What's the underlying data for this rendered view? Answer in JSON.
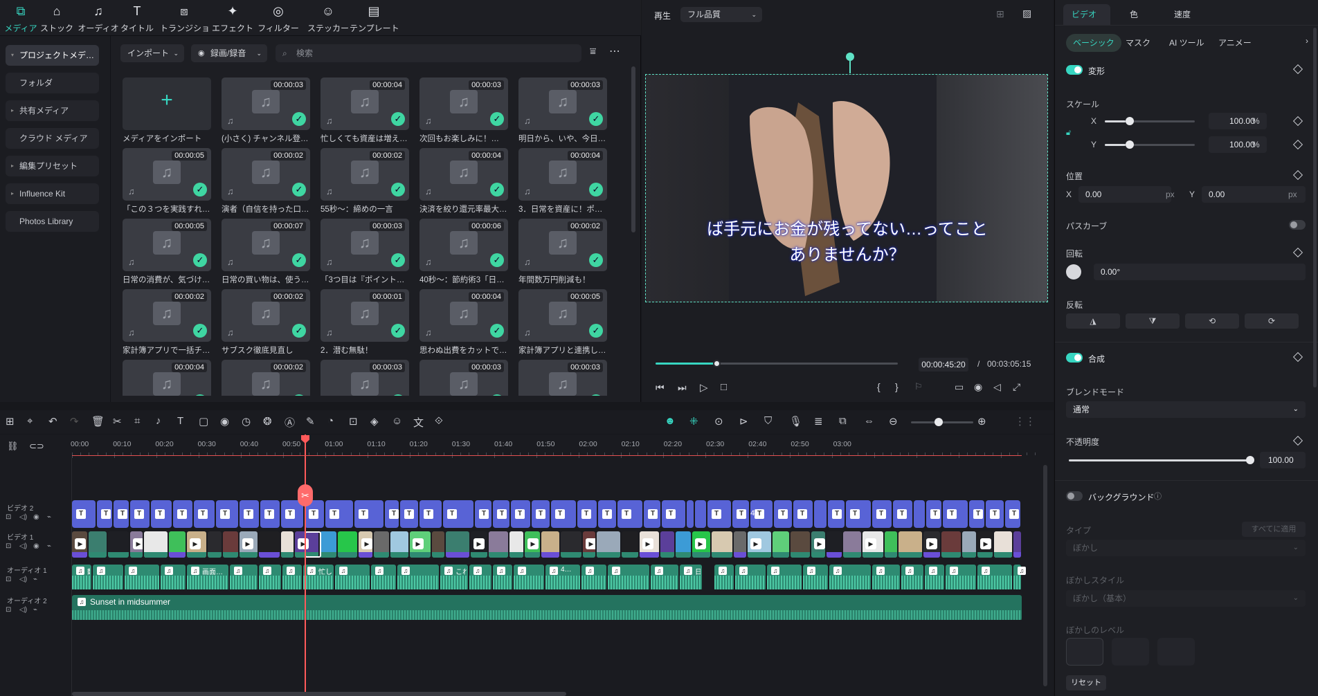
{
  "media_tabs": [
    {
      "label": "メディア",
      "icon": "media-icon",
      "active": true
    },
    {
      "label": "ストック",
      "icon": "stock-icon"
    },
    {
      "label": "オーディオ",
      "icon": "audio-icon"
    },
    {
      "label": "タイトル",
      "icon": "title-icon"
    },
    {
      "label": "トランジション",
      "icon": "transition-icon"
    },
    {
      "label": "エフェクト",
      "icon": "effect-icon"
    },
    {
      "label": "フィルター",
      "icon": "filter-icon"
    },
    {
      "label": "ステッカー",
      "icon": "sticker-icon"
    },
    {
      "label": "テンプレート",
      "icon": "template-icon"
    }
  ],
  "sidebar": {
    "items": [
      {
        "label": "プロジェクトメデ…",
        "caret": "▾",
        "selected": true
      },
      {
        "label": "フォルダ"
      },
      {
        "label": "共有メディア",
        "caret": "▸"
      },
      {
        "label": "クラウド メディア"
      },
      {
        "label": "編集プリセット",
        "caret": "▸"
      },
      {
        "label": "Influence Kit",
        "caret": "▸"
      },
      {
        "label": "Photos Library"
      }
    ]
  },
  "toolbar": {
    "import_label": "インポート",
    "record_label": "録画/録音",
    "search_placeholder": "検索"
  },
  "media_items": [
    {
      "name": "メディアをインポート",
      "import": true
    },
    {
      "name": "(小さく) チャンネル登…",
      "duration": "00:00:03"
    },
    {
      "name": "忙しくても資産は増え…",
      "duration": "00:00:04"
    },
    {
      "name": "次回もお楽しみに！…",
      "duration": "00:00:03"
    },
    {
      "name": "明日から、いや、今日…",
      "duration": "00:00:03"
    },
    {
      "name": "「この３つを実践すれ…",
      "duration": "00:00:05"
    },
    {
      "name": "演者（自信を持った口…",
      "duration": "00:00:02"
    },
    {
      "name": "55秒～：締めの一言",
      "duration": "00:00:02"
    },
    {
      "name": "決済を絞り還元率最大…",
      "duration": "00:00:04"
    },
    {
      "name": "3．日常を資産に！ポ…",
      "duration": "00:00:04"
    },
    {
      "name": "日常の消費が、気づけ…",
      "duration": "00:00:05"
    },
    {
      "name": "日常の買い物は、使う…",
      "duration": "00:00:07"
    },
    {
      "name": "「3つ目は『ポイント…",
      "duration": "00:00:03"
    },
    {
      "name": "40秒～：節約術3「日…",
      "duration": "00:00:06"
    },
    {
      "name": "年間数万円削減も！",
      "duration": "00:00:02"
    },
    {
      "name": "家計簿アプリで一括チ…",
      "duration": "00:00:02"
    },
    {
      "name": "サブスク徹底見直し",
      "duration": "00:00:02"
    },
    {
      "name": "2．潜む無駄！",
      "duration": "00:00:01"
    },
    {
      "name": "思わぬ出費をカットで…",
      "duration": "00:00:04"
    },
    {
      "name": "家計簿アプリと連携し…",
      "duration": "00:00:05"
    },
    {
      "name": "",
      "duration": "00:00:04"
    },
    {
      "name": "",
      "duration": "00:00:02"
    },
    {
      "name": "",
      "duration": "00:00:03"
    },
    {
      "name": "",
      "duration": "00:00:03"
    },
    {
      "name": "",
      "duration": "00:00:03"
    }
  ],
  "preview": {
    "play_label": "再生",
    "quality": "フル品質",
    "subtitle_line1": "ば手元にお金が残ってない…ってこと",
    "subtitle_line2": "ありませんか？",
    "current_time": "00:00:45:20",
    "separator": "/",
    "total_time": "00:03:05:15",
    "progress": 0.25
  },
  "props": {
    "tabs": [
      "ビデオ",
      "色",
      "速度"
    ],
    "subtabs": [
      "ベーシック",
      "マスク",
      "AI ツール",
      "アニメー"
    ],
    "transform_label": "変形",
    "scale_label": "スケール",
    "scale_x_label": "X",
    "scale_y_label": "Y",
    "scale_x": "100.00",
    "scale_y": "100.00",
    "percent": "%",
    "position_label": "位置",
    "pos_x_label": "X",
    "pos_x": "0.00",
    "pos_y_label": "Y",
    "pos_y": "0.00",
    "px": "px",
    "path_curve_label": "パスカーブ",
    "rotation_label": "回転",
    "rotation": "0.00°",
    "flip_label": "反転",
    "composite_label": "合成",
    "blend_mode_label": "ブレンドモード",
    "blend_mode": "通常",
    "opacity_label": "不透明度",
    "opacity": "100.00",
    "background_label": "バックグラウンド",
    "type_label": "タイプ",
    "apply_all": "すべてに適用",
    "blur": "ぼかし",
    "blur_style_label": "ぼかしスタイル",
    "blur_style": "ぼかし（基本）",
    "blur_level_label": "ぼかしのレベル",
    "reset": "リセット"
  },
  "timeline": {
    "ticks": [
      "00:00",
      "00:10",
      "00:20",
      "00:30",
      "00:40",
      "00:50",
      "01:00",
      "01:10",
      "01:20",
      "01:30",
      "01:40",
      "01:50",
      "02:00",
      "02:10",
      "02:20",
      "02:30",
      "02:40",
      "02:50",
      "03:00"
    ],
    "tracks": [
      {
        "label": "ビデオ 2"
      },
      {
        "label": "ビデオ 1"
      },
      {
        "label": "オーディオ 1"
      },
      {
        "label": "オーディオ 2"
      }
    ],
    "audio2_clip": "Sunset in midsummer",
    "audio1_clip_labels": [
      "動…",
      "画面…",
      "忙し…",
      "これ…",
      "4…",
      "日…"
    ],
    "title_clip_label": "4…",
    "accent": "#37d6c1",
    "playhead_color": "#ff5a5a"
  }
}
